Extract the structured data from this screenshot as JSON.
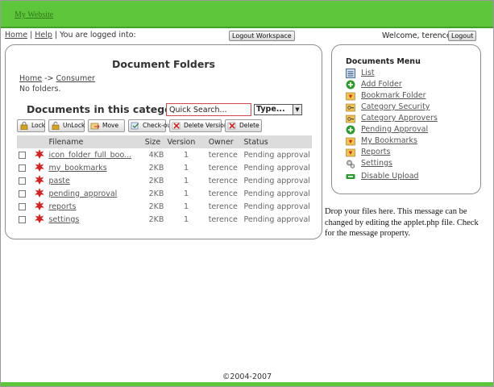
{
  "header": {
    "site_title": "My Website"
  },
  "nav": {
    "home": "Home",
    "separator": "|",
    "help": "Help",
    "logged_in_text": "You are logged into:",
    "logout_workspace": "Logout Workspace",
    "welcome": "Welcome, terence",
    "logout": "Logout"
  },
  "main": {
    "folders_title": "Document Folders",
    "breadcrumb": {
      "home": "Home",
      "arrow": "->",
      "current": "Consumer"
    },
    "no_folders": "No folders.",
    "category_title": "Documents in this category",
    "search": {
      "value": "Quick Search..."
    },
    "type_select": {
      "selected": "Type..."
    },
    "toolbar": {
      "lock": "Lock",
      "unlock": "UnLock",
      "move": "Move",
      "checkout": "Check-out",
      "delete_version": "Delete Version",
      "delete": "Delete"
    },
    "table": {
      "columns": [
        "Filename",
        "Size",
        "Version",
        "Owner",
        "Status"
      ],
      "rows": [
        {
          "name": "icon_folder_full_boo...",
          "size": "4KB",
          "version": "1",
          "owner": "terence",
          "status": "Pending approval"
        },
        {
          "name": "my_bookmarks",
          "size": "2KB",
          "version": "1",
          "owner": "terence",
          "status": "Pending approval"
        },
        {
          "name": "paste",
          "size": "2KB",
          "version": "1",
          "owner": "terence",
          "status": "Pending approval"
        },
        {
          "name": "pending_approval",
          "size": "2KB",
          "version": "1",
          "owner": "terence",
          "status": "Pending approval"
        },
        {
          "name": "reports",
          "size": "2KB",
          "version": "1",
          "owner": "terence",
          "status": "Pending approval"
        },
        {
          "name": "settings",
          "size": "2KB",
          "version": "1",
          "owner": "terence",
          "status": "Pending approval"
        }
      ]
    }
  },
  "menu": {
    "title": "Documents Menu",
    "items": [
      {
        "label": "List",
        "icon": "list-icon"
      },
      {
        "label": "Add Folder",
        "icon": "add-folder-icon"
      },
      {
        "label": "Bookmark Folder",
        "icon": "bookmark-icon"
      },
      {
        "label": "Category Security",
        "icon": "key-icon"
      },
      {
        "label": "Category Approvers",
        "icon": "key-icon"
      },
      {
        "label": "Pending Approval",
        "icon": "plus-icon"
      },
      {
        "label": "My Bookmarks",
        "icon": "bookmark-icon"
      },
      {
        "label": "Reports",
        "icon": "bookmark-icon"
      },
      {
        "label": "Settings",
        "icon": "gears-icon"
      },
      {
        "label": "Disable Upload",
        "icon": "minus-icon"
      }
    ]
  },
  "drop_message": "Drop your files here. This message can be changed by editing the applet.php file. Check for the message property.",
  "footer": {
    "copyright": "©2004-2007"
  },
  "colors": {
    "brand_green": "#5ec63b",
    "search_border": "#d04848"
  }
}
